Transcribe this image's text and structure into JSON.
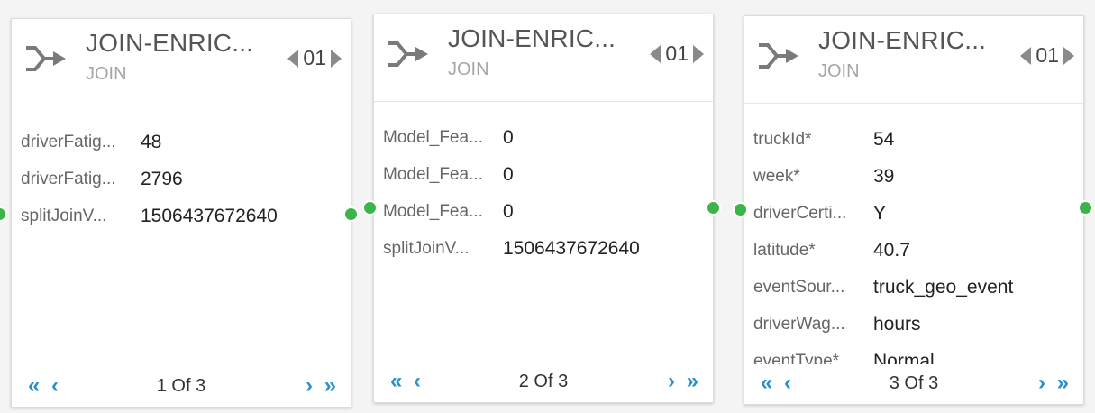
{
  "colors": {
    "accent": "#2a8fcf",
    "port": "#3bb54a",
    "title": "#555555",
    "subtitle": "#a6a6a6"
  },
  "nodes": [
    {
      "title": "JOIN-ENRIC...",
      "type": "JOIN",
      "version": "01",
      "icon": "join-arrow-icon",
      "fields": [
        {
          "key": "driverFatig...",
          "value": "48"
        },
        {
          "key": "driverFatig...",
          "value": "2796"
        },
        {
          "key": "splitJoinV...",
          "value": "1506437672640"
        }
      ],
      "pager": {
        "first": "«",
        "prev": "‹",
        "label": "1 Of 3",
        "next": "›",
        "last": "»"
      }
    },
    {
      "title": "JOIN-ENRIC...",
      "type": "JOIN",
      "version": "01",
      "icon": "join-arrow-icon",
      "fields": [
        {
          "key": "Model_Fea...",
          "value": "0"
        },
        {
          "key": "Model_Fea...",
          "value": "0"
        },
        {
          "key": "Model_Fea...",
          "value": "0"
        },
        {
          "key": "splitJoinV...",
          "value": "1506437672640"
        }
      ],
      "pager": {
        "first": "«",
        "prev": "‹",
        "label": "2 Of 3",
        "next": "›",
        "last": "»"
      }
    },
    {
      "title": "JOIN-ENRIC...",
      "type": "JOIN",
      "version": "01",
      "icon": "join-arrow-icon",
      "fields": [
        {
          "key": "truckId*",
          "value": "54"
        },
        {
          "key": "week*",
          "value": "39"
        },
        {
          "key": "driverCerti...",
          "value": "Y"
        },
        {
          "key": "latitude*",
          "value": "40.7"
        },
        {
          "key": "eventSour...",
          "value": "truck_geo_event"
        },
        {
          "key": "driverWag...",
          "value": "hours"
        },
        {
          "key": "eventType*",
          "value": "Normal"
        }
      ],
      "pager": {
        "first": "«",
        "prev": "‹",
        "label": "3 Of 3",
        "next": "›",
        "last": "»"
      }
    }
  ]
}
